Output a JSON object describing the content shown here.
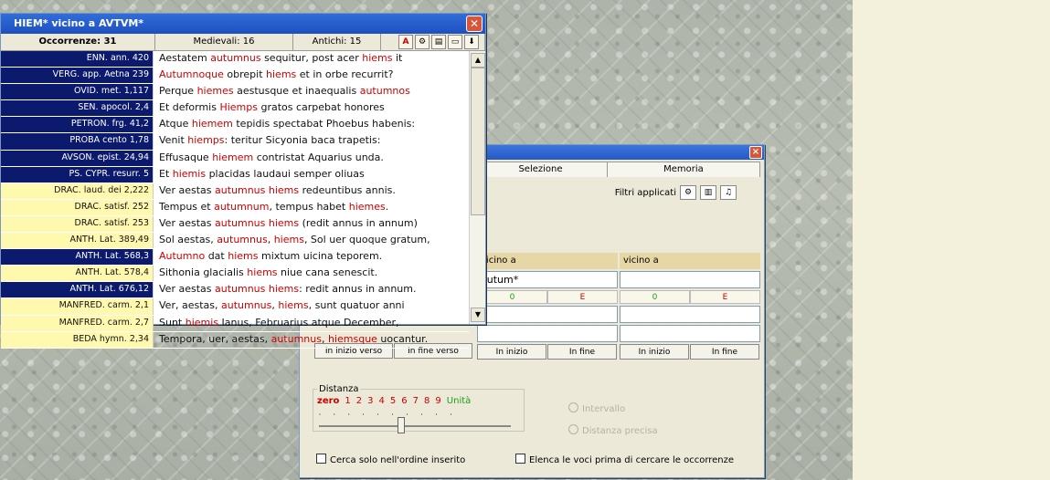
{
  "concordance": {
    "title": "HIEM* vicino a AVTVM*",
    "occurrences": "Occorrenze: 31",
    "medieval": "Medievali: 16",
    "ancient": "Antichi: 15",
    "rows": [
      {
        "ref": "ENN. ann. 420",
        "tone": "dark",
        "parts": [
          "Aestatem ",
          "autumnus",
          " sequitur, post acer ",
          "hiems",
          " it"
        ]
      },
      {
        "ref": "VERG. app. Aetna 239",
        "tone": "dark",
        "parts": [
          "",
          "Autumnoque",
          " obrepit ",
          "hiems",
          " et in orbe recurrit?"
        ]
      },
      {
        "ref": "OVID. met. 1,117",
        "tone": "dark",
        "parts": [
          "Perque ",
          "hiemes",
          " aestusque et inaequalis ",
          "autumnos",
          ""
        ]
      },
      {
        "ref": "SEN. apocol. 2,4",
        "tone": "dark",
        "parts": [
          "Et deformis ",
          "Hiemps",
          " gratos carpebat honores",
          "",
          ""
        ]
      },
      {
        "ref": "PETRON. frg. 41,2",
        "tone": "dark",
        "parts": [
          "Atque ",
          "hiemem",
          " tepidis spectabat Phoebus habenis:",
          "",
          ""
        ]
      },
      {
        "ref": "PROBA cento 1,78",
        "tone": "dark",
        "parts": [
          "Venit ",
          "hiemps",
          ": teritur Sicyonia baca trapetis:",
          "",
          ""
        ]
      },
      {
        "ref": "AVSON. epist. 24,94",
        "tone": "dark",
        "parts": [
          "Effusaque ",
          "hiemem",
          " contristat Aquarius unda.",
          "",
          ""
        ]
      },
      {
        "ref": "PS. CYPR. resurr. 5",
        "tone": "dark",
        "parts": [
          "Et ",
          "hiemis",
          " placidas laudaui semper oliuas",
          "",
          ""
        ]
      },
      {
        "ref": "DRAC. laud. dei 2,222",
        "tone": "light",
        "parts": [
          "Ver aestas ",
          "autumnus hiems",
          " redeuntibus annis.",
          "",
          ""
        ]
      },
      {
        "ref": "DRAC. satisf. 252",
        "tone": "light",
        "parts": [
          "Tempus et ",
          "autumnum",
          ", tempus habet ",
          "hiemes",
          "."
        ]
      },
      {
        "ref": "DRAC. satisf. 253",
        "tone": "light",
        "parts": [
          "Ver aestas ",
          "autumnus hiems",
          " (redit annus in annum)",
          "",
          ""
        ]
      },
      {
        "ref": "ANTH. Lat. 389,49",
        "tone": "light",
        "parts": [
          "Sol aestas, ",
          "autumnus",
          ", ",
          "hiems",
          ", Sol uer quoque gratum,"
        ]
      },
      {
        "ref": "ANTH. Lat. 568,3",
        "tone": "dark",
        "parts": [
          "",
          "Autumno",
          " dat ",
          "hiems",
          " mixtum uicina teporem."
        ]
      },
      {
        "ref": "ANTH. Lat. 578,4",
        "tone": "light",
        "parts": [
          "Sithonia glacialis ",
          "hiems",
          " niue cana senescit.",
          "",
          ""
        ]
      },
      {
        "ref": "ANTH. Lat. 676,12",
        "tone": "dark",
        "parts": [
          "Ver aestas ",
          "autumnus hiems",
          ": redit annus in annum.",
          "",
          ""
        ]
      },
      {
        "ref": "MANFRED. carm. 2,1",
        "tone": "light",
        "parts": [
          "Ver, aestas, ",
          "autumnus",
          ", ",
          "hiems",
          ", sunt quatuor anni"
        ]
      },
      {
        "ref": "MANFRED. carm. 2,7",
        "tone": "light",
        "parts": [
          "Sunt ",
          "hiemis",
          " Ianus, Februarius atque December,",
          "",
          ""
        ]
      },
      {
        "ref": "BEDA hymn. 2,34",
        "tone": "light",
        "parts": [
          "Tempora, uer, aestas, ",
          "autumnus",
          ", ",
          "hiemsque",
          " uocantur."
        ]
      }
    ]
  },
  "search": {
    "tab_selection": "Selezione",
    "tab_memory": "Memoria",
    "filters_label": "Filtri applicati",
    "col2_head": "vicino a",
    "col2_value": "autum*",
    "col3_head": "vicino a",
    "col3_value": "",
    "zero_label": "0",
    "e_label": "E",
    "btn_start_verse": "In inizio verso",
    "btn_end_verse": "In fine verso",
    "btn_start": "In inizio",
    "btn_end": "In fine",
    "distance_legend": "Distanza",
    "scale": [
      "zero",
      "1",
      "2",
      "3",
      "4",
      "5",
      "6",
      "7",
      "8",
      "9",
      "Unità"
    ],
    "radio_interval": "Intervallo",
    "radio_exact": "Distanza precisa",
    "cb_order": "Cerca solo nell'ordine inserito",
    "cb_list": "Elenca le voci prima di cercare le occorrenze"
  }
}
